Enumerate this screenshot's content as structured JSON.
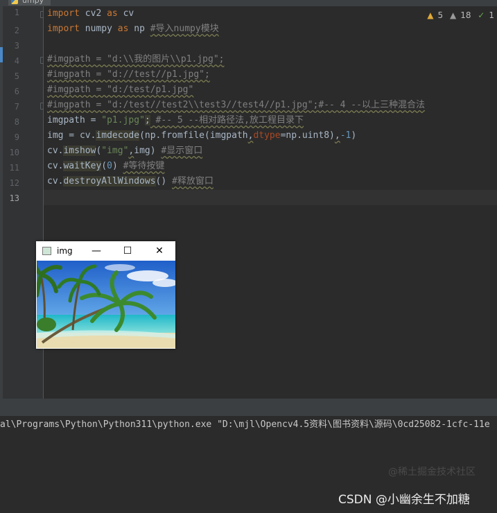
{
  "tab": {
    "label": "umpy"
  },
  "inspections": {
    "warnings": "5",
    "weak_warnings": "18",
    "ok": "1"
  },
  "line_numbers": [
    "1",
    "2",
    "3",
    "4",
    "5",
    "6",
    "7",
    "8",
    "9",
    "10",
    "11",
    "12",
    "13"
  ],
  "code": {
    "l1": {
      "kw1": "import",
      "mod": " cv2 ",
      "kw2": "as",
      "alias": " cv"
    },
    "l2": {
      "kw1": "import",
      "mod": " numpy ",
      "kw2": "as",
      "alias": " np ",
      "comment": "#导入numpy模块"
    },
    "l4": "#imgpath = \"d:\\\\我的图片\\\\p1.jpg\";",
    "l5": "#imgpath = \"d://test//p1.jpg\";",
    "l6": "#imgpath = \"d:/test/p1.jpg\"",
    "l7": "#imgpath = \"d:/test//test2\\\\test3//test4//p1.jpg\";#-- 4 --以上三种混合法",
    "l8": {
      "var": "imgpath = ",
      "str": "\"p1.jpg\"",
      "semi": ";",
      "comment": " #-- 5 --相对路径法,放工程目录下"
    },
    "l9": {
      "a": "img = cv.",
      "fn": "imdecode",
      "b": "(np.fromfile(imgpath",
      "c": ",",
      "param": "dtype",
      "d": "=np.uint8)",
      "e": ",",
      "num": "-1",
      "f": ")"
    },
    "l10": {
      "a": "cv.",
      "fn": "imshow",
      "b": "(",
      "str": "\"img\"",
      "c": ",",
      "d": "img) ",
      "comment": "#显示窗口"
    },
    "l11": {
      "a": "cv.",
      "fn": "waitKey",
      "b": "(",
      "num": "0",
      "c": ") ",
      "comment": "#等待按键"
    },
    "l12": {
      "a": "cv.",
      "fn": "destroyAllWindows",
      "b": "() ",
      "comment": "#释放窗口"
    }
  },
  "img_window": {
    "title": "img",
    "minimize": "—",
    "maximize": "☐",
    "close": "✕"
  },
  "console": {
    "line": "al\\Programs\\Python\\Python311\\python.exe \"D:\\mjl\\Opencv4.5资料\\图书资料\\源码\\0cd25082-1cfc-11e"
  },
  "watermarks": {
    "site": "@稀土掘金技术社区",
    "author": "CSDN @小幽余生不加糖"
  },
  "colors": {
    "editor_bg": "#2b2b2b",
    "keyword": "#cc7832",
    "string": "#6a8759",
    "comment": "#808080",
    "number": "#6897bb"
  }
}
